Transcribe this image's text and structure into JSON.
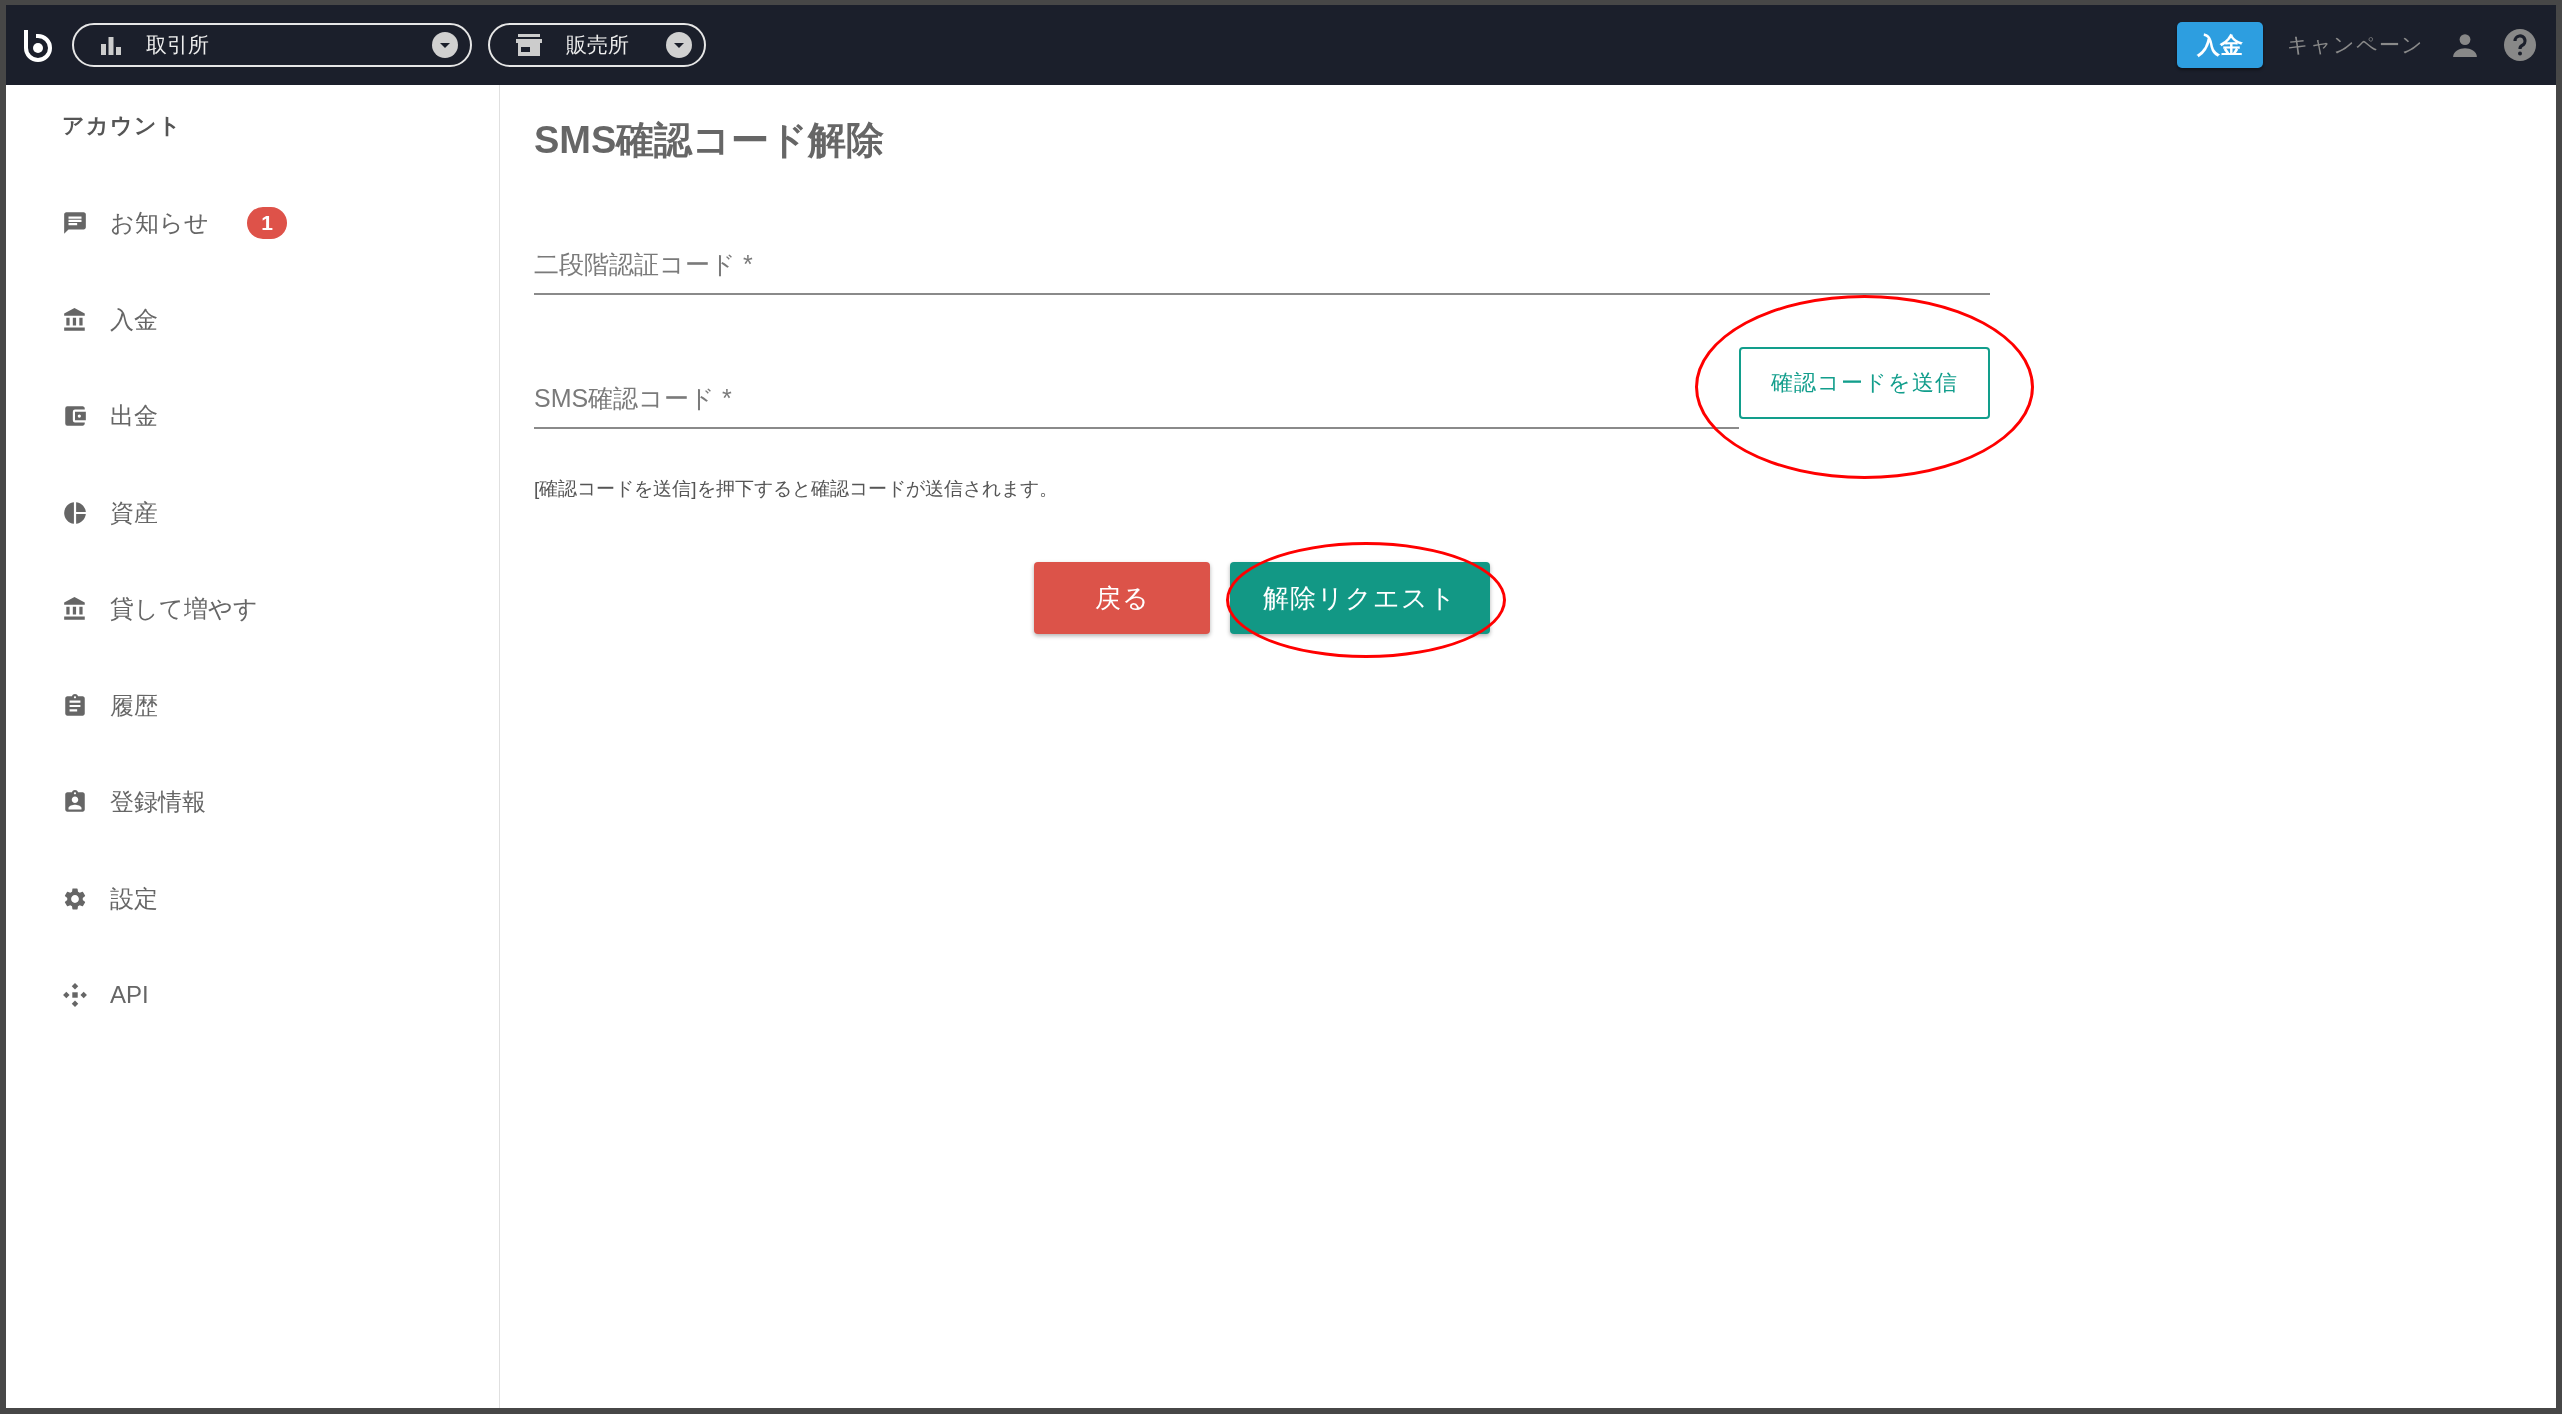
{
  "header": {
    "market_selectors": [
      {
        "label": "取引所",
        "kind": "chart"
      },
      {
        "label": "販売所",
        "kind": "store"
      }
    ],
    "deposit_button": "入金",
    "campaign_link": "キャンペーン"
  },
  "sidebar": {
    "heading": "アカウント",
    "items": [
      {
        "label": "お知らせ",
        "kind": "message",
        "badge": "1"
      },
      {
        "label": "入金",
        "kind": "bank"
      },
      {
        "label": "出金",
        "kind": "wallet"
      },
      {
        "label": "資産",
        "kind": "pie"
      },
      {
        "label": "貸して増やす",
        "kind": "bank"
      },
      {
        "label": "履歴",
        "kind": "clipboard"
      },
      {
        "label": "登録情報",
        "kind": "badge"
      },
      {
        "label": "設定",
        "kind": "gear"
      },
      {
        "label": "API",
        "kind": "api"
      }
    ]
  },
  "page": {
    "title": "SMS確認コード解除",
    "fields": [
      {
        "placeholder": "二段階認証コード *"
      },
      {
        "placeholder": "SMS確認コード *",
        "action": {
          "label": "確認コードを送信",
          "circled": true
        }
      }
    ],
    "hint": "[確認コードを送信]を押下すると確認コードが送信されます。",
    "buttons": [
      {
        "label": "戻る",
        "kind": "back",
        "circled": false
      },
      {
        "label": "解除リクエスト",
        "kind": "submit",
        "circled": true
      }
    ]
  }
}
